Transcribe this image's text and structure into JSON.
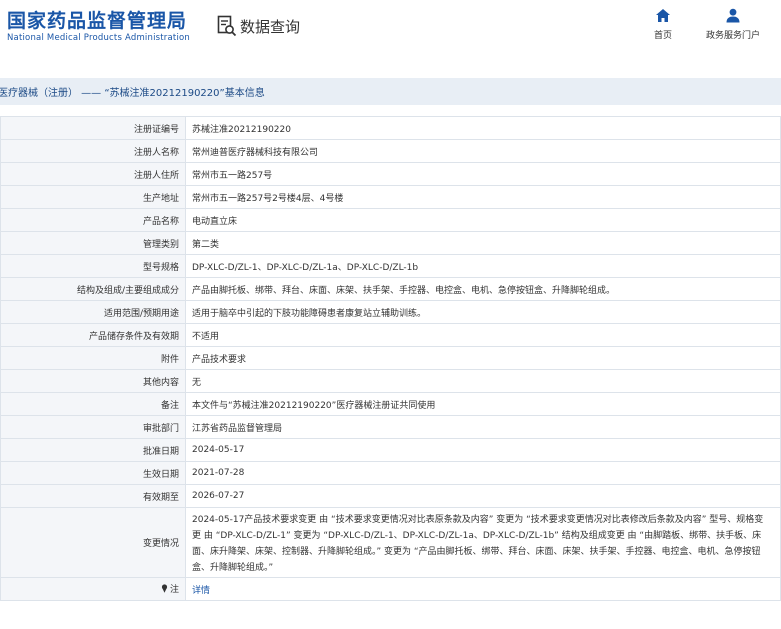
{
  "header": {
    "brand_cn": "国家药品监督管理局",
    "brand_en": "National Medical Products Administration",
    "query_label": "数据查询",
    "query_icon": "search-document-icon",
    "nav": [
      {
        "label": "首页",
        "icon": "home-icon"
      },
      {
        "label": "政务服务门户",
        "icon": "user-icon"
      }
    ],
    "brand_color": "#1a56a7"
  },
  "title_band": {
    "text": "医疗器械（注册） —— “苏械注准20212190220”基本信息"
  },
  "rows": [
    {
      "label": "注册证编号",
      "value": "苏械注准20212190220"
    },
    {
      "label": "注册人名称",
      "value": "常州迪普医疗器械科技有限公司"
    },
    {
      "label": "注册人住所",
      "value": "常州市五一路257号"
    },
    {
      "label": "生产地址",
      "value": "常州市五一路257号2号楼4层、4号楼"
    },
    {
      "label": "产品名称",
      "value": "电动直立床"
    },
    {
      "label": "管理类别",
      "value": "第二类"
    },
    {
      "label": "型号规格",
      "value": "DP-XLC-D/ZL-1、DP-XLC-D/ZL-1a、DP-XLC-D/ZL-1b"
    },
    {
      "label": "结构及组成/主要组成成分",
      "value": "产品由脚托板、绑带、拜台、床面、床架、扶手架、手控器、电控盒、电机、急停按钮盒、升降脚轮组成。"
    },
    {
      "label": "适用范围/预期用途",
      "value": "适用于脑卒中引起的下肢功能障碍患者康复站立辅助训练。"
    },
    {
      "label": "产品储存条件及有效期",
      "value": "不适用"
    },
    {
      "label": "附件",
      "value": "产品技术要求"
    },
    {
      "label": "其他内容",
      "value": "无"
    },
    {
      "label": "备注",
      "value": "本文件与“苏械注准20212190220”医疗器械注册证共同使用"
    },
    {
      "label": "审批部门",
      "value": "江苏省药品监督管理局"
    },
    {
      "label": "批准日期",
      "value": "2024-05-17"
    },
    {
      "label": "生效日期",
      "value": "2021-07-28"
    },
    {
      "label": "有效期至",
      "value": "2026-07-27"
    }
  ],
  "change": {
    "label": "变更情况",
    "value": "2024-05-17产品技术要求变更 由 “技术要求变更情况对比表原条款及内容” 变更为 “技术要求变更情况对比表修改后条款及内容” 型号、规格变更 由 “DP-XLC-D/ZL-1” 变更为 “DP-XLC-D/ZL-1、DP-XLC-D/ZL-1a、DP-XLC-D/ZL-1b” 结构及组成变更 由 “由脚踏板、绑带、扶手板、床面、床升降架、床架、控制器、升降脚轮组成。” 变更为 “产品由脚托板、绑带、拜台、床面、床架、扶手架、手控器、电控盒、电机、急停按钮盒、升降脚轮组成。”"
  },
  "note": {
    "label": "注",
    "icon": "pin-icon",
    "link": "详情"
  }
}
